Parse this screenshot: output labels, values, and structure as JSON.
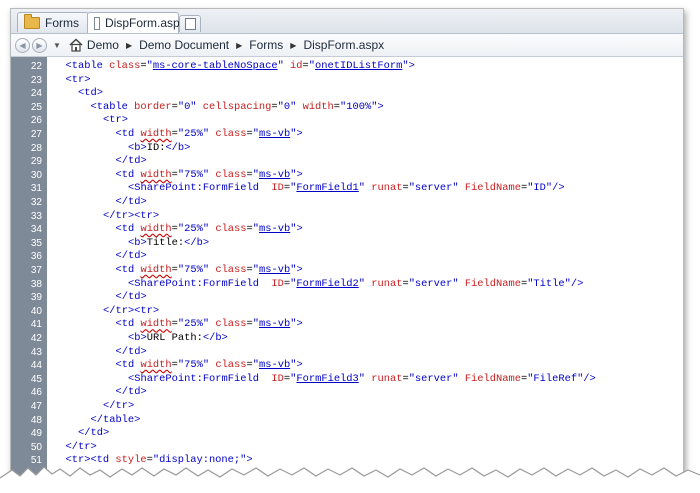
{
  "tabs": [
    {
      "label": "Forms",
      "icon": "folder-icon",
      "active": false
    },
    {
      "label": "DispForm.aspx",
      "icon": "document-icon",
      "active": true
    }
  ],
  "breadcrumb": [
    "Demo",
    "Demo Document",
    "Forms",
    "DispForm.aspx"
  ],
  "colors": {
    "tag": "#0000c8",
    "attribute": "#c81e1e",
    "gutter": "#7f8a98"
  },
  "code": {
    "lines": [
      {
        "n": "22",
        "indent": 2,
        "parts": [
          {
            "k": "t",
            "s": "<table "
          },
          {
            "k": "a",
            "s": "class"
          },
          {
            "k": "p",
            "s": "="
          },
          {
            "k": "v",
            "s": "\""
          },
          {
            "k": "v link",
            "s": "ms-core-tableNoSpace"
          },
          {
            "k": "v",
            "s": "\" "
          },
          {
            "k": "a",
            "s": "id"
          },
          {
            "k": "p",
            "s": "="
          },
          {
            "k": "v",
            "s": "\""
          },
          {
            "k": "v link",
            "s": "onetIDListForm"
          },
          {
            "k": "v",
            "s": "\">"
          }
        ]
      },
      {
        "n": "23",
        "indent": 2,
        "parts": [
          {
            "k": "t",
            "s": "<tr>"
          }
        ]
      },
      {
        "n": "24",
        "indent": 4,
        "parts": [
          {
            "k": "t",
            "s": "<td>"
          }
        ]
      },
      {
        "n": "25",
        "indent": 6,
        "parts": [
          {
            "k": "t",
            "s": "<table "
          },
          {
            "k": "a",
            "s": "border"
          },
          {
            "k": "p",
            "s": "="
          },
          {
            "k": "v",
            "s": "\"0\" "
          },
          {
            "k": "a",
            "s": "cellspacing"
          },
          {
            "k": "p",
            "s": "="
          },
          {
            "k": "v",
            "s": "\"0\" "
          },
          {
            "k": "a",
            "s": "width"
          },
          {
            "k": "p",
            "s": "="
          },
          {
            "k": "v",
            "s": "\"100%\">"
          }
        ]
      },
      {
        "n": "26",
        "indent": 8,
        "parts": [
          {
            "k": "t",
            "s": "<tr>"
          }
        ]
      },
      {
        "n": "27",
        "indent": 10,
        "parts": [
          {
            "k": "t",
            "s": "<td "
          },
          {
            "k": "a sq",
            "s": "width"
          },
          {
            "k": "p",
            "s": "="
          },
          {
            "k": "v sq",
            "s": "\"25%\""
          },
          {
            "k": "t",
            "s": " "
          },
          {
            "k": "a",
            "s": "class"
          },
          {
            "k": "p",
            "s": "="
          },
          {
            "k": "v",
            "s": "\""
          },
          {
            "k": "v link",
            "s": "ms-vb"
          },
          {
            "k": "v",
            "s": "\">"
          }
        ]
      },
      {
        "n": "28",
        "indent": 12,
        "parts": [
          {
            "k": "t",
            "s": "<b>"
          },
          {
            "k": "p",
            "s": "ID:"
          },
          {
            "k": "t",
            "s": "</b>"
          }
        ]
      },
      {
        "n": "29",
        "indent": 10,
        "parts": [
          {
            "k": "t",
            "s": "</td>"
          }
        ]
      },
      {
        "n": "30",
        "indent": 10,
        "parts": [
          {
            "k": "t",
            "s": "<td "
          },
          {
            "k": "a sq",
            "s": "width"
          },
          {
            "k": "p",
            "s": "="
          },
          {
            "k": "v sq",
            "s": "\"75%\""
          },
          {
            "k": "t",
            "s": " "
          },
          {
            "k": "a",
            "s": "class"
          },
          {
            "k": "p",
            "s": "="
          },
          {
            "k": "v",
            "s": "\""
          },
          {
            "k": "v link",
            "s": "ms-vb"
          },
          {
            "k": "v",
            "s": "\">"
          }
        ]
      },
      {
        "n": "31",
        "indent": 12,
        "parts": [
          {
            "k": "t",
            "s": "<SharePoint:FormField  "
          },
          {
            "k": "a",
            "s": "ID"
          },
          {
            "k": "p",
            "s": "="
          },
          {
            "k": "v",
            "s": "\""
          },
          {
            "k": "v link",
            "s": "FormField1"
          },
          {
            "k": "v",
            "s": "\" "
          },
          {
            "k": "a",
            "s": "runat"
          },
          {
            "k": "p",
            "s": "="
          },
          {
            "k": "v",
            "s": "\"server\" "
          },
          {
            "k": "a",
            "s": "FieldName"
          },
          {
            "k": "p",
            "s": "="
          },
          {
            "k": "v",
            "s": "\"ID\"/>"
          }
        ]
      },
      {
        "n": "32",
        "indent": 10,
        "parts": [
          {
            "k": "t",
            "s": "</td>"
          }
        ]
      },
      {
        "n": "33",
        "indent": 8,
        "parts": [
          {
            "k": "t",
            "s": "</tr><tr>"
          }
        ]
      },
      {
        "n": "34",
        "indent": 10,
        "parts": [
          {
            "k": "t",
            "s": "<td "
          },
          {
            "k": "a sq",
            "s": "width"
          },
          {
            "k": "p",
            "s": "="
          },
          {
            "k": "v sq",
            "s": "\"25%\""
          },
          {
            "k": "t",
            "s": " "
          },
          {
            "k": "a",
            "s": "class"
          },
          {
            "k": "p",
            "s": "="
          },
          {
            "k": "v",
            "s": "\""
          },
          {
            "k": "v link",
            "s": "ms-vb"
          },
          {
            "k": "v",
            "s": "\">"
          }
        ]
      },
      {
        "n": "35",
        "indent": 12,
        "parts": [
          {
            "k": "t",
            "s": "<b>"
          },
          {
            "k": "p",
            "s": "Title:"
          },
          {
            "k": "t",
            "s": "</b>"
          }
        ]
      },
      {
        "n": "36",
        "indent": 10,
        "parts": [
          {
            "k": "t",
            "s": "</td>"
          }
        ]
      },
      {
        "n": "37",
        "indent": 10,
        "parts": [
          {
            "k": "t",
            "s": "<td "
          },
          {
            "k": "a sq",
            "s": "width"
          },
          {
            "k": "p",
            "s": "="
          },
          {
            "k": "v sq",
            "s": "\"75%\""
          },
          {
            "k": "t",
            "s": " "
          },
          {
            "k": "a",
            "s": "class"
          },
          {
            "k": "p",
            "s": "="
          },
          {
            "k": "v",
            "s": "\""
          },
          {
            "k": "v link",
            "s": "ms-vb"
          },
          {
            "k": "v",
            "s": "\">"
          }
        ]
      },
      {
        "n": "38",
        "indent": 12,
        "parts": [
          {
            "k": "t",
            "s": "<SharePoint:FormField  "
          },
          {
            "k": "a",
            "s": "ID"
          },
          {
            "k": "p",
            "s": "="
          },
          {
            "k": "v",
            "s": "\""
          },
          {
            "k": "v link",
            "s": "FormField2"
          },
          {
            "k": "v",
            "s": "\" "
          },
          {
            "k": "a",
            "s": "runat"
          },
          {
            "k": "p",
            "s": "="
          },
          {
            "k": "v",
            "s": "\"server\" "
          },
          {
            "k": "a",
            "s": "FieldName"
          },
          {
            "k": "p",
            "s": "="
          },
          {
            "k": "v",
            "s": "\"Title\"/>"
          }
        ]
      },
      {
        "n": "39",
        "indent": 10,
        "parts": [
          {
            "k": "t",
            "s": "</td>"
          }
        ]
      },
      {
        "n": "40",
        "indent": 8,
        "parts": [
          {
            "k": "t",
            "s": "</tr><tr>"
          }
        ]
      },
      {
        "n": "41",
        "indent": 10,
        "parts": [
          {
            "k": "t",
            "s": "<td "
          },
          {
            "k": "a sq",
            "s": "width"
          },
          {
            "k": "p",
            "s": "="
          },
          {
            "k": "v sq",
            "s": "\"25%\""
          },
          {
            "k": "t",
            "s": " "
          },
          {
            "k": "a",
            "s": "class"
          },
          {
            "k": "p",
            "s": "="
          },
          {
            "k": "v",
            "s": "\""
          },
          {
            "k": "v link",
            "s": "ms-vb"
          },
          {
            "k": "v",
            "s": "\">"
          }
        ]
      },
      {
        "n": "42",
        "indent": 12,
        "parts": [
          {
            "k": "t",
            "s": "<b>"
          },
          {
            "k": "p",
            "s": "URL Path:"
          },
          {
            "k": "t",
            "s": "</b>"
          }
        ]
      },
      {
        "n": "43",
        "indent": 10,
        "parts": [
          {
            "k": "t",
            "s": "</td>"
          }
        ]
      },
      {
        "n": "44",
        "indent": 10,
        "parts": [
          {
            "k": "t",
            "s": "<td "
          },
          {
            "k": "a sq",
            "s": "width"
          },
          {
            "k": "p",
            "s": "="
          },
          {
            "k": "v sq",
            "s": "\"75%\""
          },
          {
            "k": "t",
            "s": " "
          },
          {
            "k": "a",
            "s": "class"
          },
          {
            "k": "p",
            "s": "="
          },
          {
            "k": "v",
            "s": "\""
          },
          {
            "k": "v link",
            "s": "ms-vb"
          },
          {
            "k": "v",
            "s": "\">"
          }
        ]
      },
      {
        "n": "45",
        "indent": 12,
        "parts": [
          {
            "k": "t",
            "s": "<SharePoint:FormField  "
          },
          {
            "k": "a",
            "s": "ID"
          },
          {
            "k": "p",
            "s": "="
          },
          {
            "k": "v",
            "s": "\""
          },
          {
            "k": "v link",
            "s": "FormField3"
          },
          {
            "k": "v",
            "s": "\" "
          },
          {
            "k": "a",
            "s": "runat"
          },
          {
            "k": "p",
            "s": "="
          },
          {
            "k": "v",
            "s": "\"server\" "
          },
          {
            "k": "a",
            "s": "FieldName"
          },
          {
            "k": "p",
            "s": "="
          },
          {
            "k": "v",
            "s": "\"FileRef\"/>"
          }
        ]
      },
      {
        "n": "46",
        "indent": 10,
        "parts": [
          {
            "k": "t",
            "s": "</td>"
          }
        ]
      },
      {
        "n": "47",
        "indent": 8,
        "parts": [
          {
            "k": "t",
            "s": "</tr>"
          }
        ]
      },
      {
        "n": "48",
        "indent": 6,
        "parts": [
          {
            "k": "t",
            "s": "</table>"
          }
        ]
      },
      {
        "n": "49",
        "indent": 4,
        "parts": [
          {
            "k": "t",
            "s": "</td>"
          }
        ]
      },
      {
        "n": "50",
        "indent": 2,
        "parts": [
          {
            "k": "t",
            "s": "</tr>"
          }
        ]
      },
      {
        "n": "51",
        "indent": 2,
        "parts": [
          {
            "k": "t",
            "s": "<tr><td "
          },
          {
            "k": "a",
            "s": "style"
          },
          {
            "k": "p",
            "s": "="
          },
          {
            "k": "v",
            "s": "\"display:none;\">"
          }
        ]
      }
    ]
  }
}
